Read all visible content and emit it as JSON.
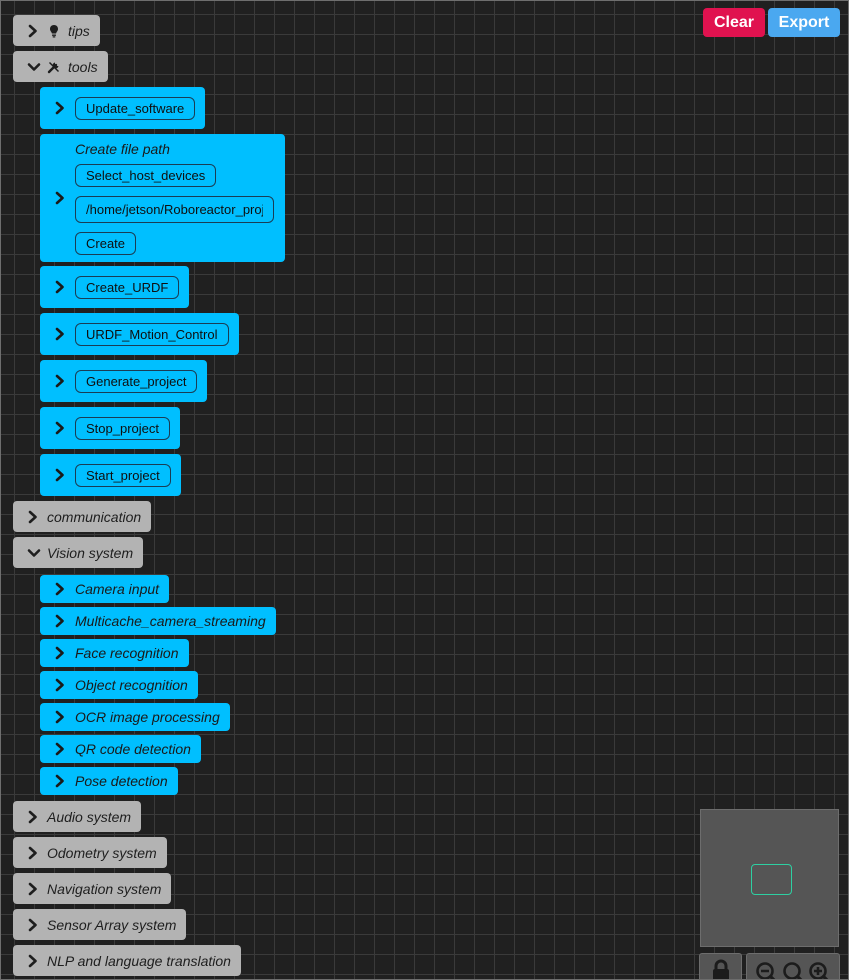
{
  "toolbar": {
    "clear_label": "Clear",
    "export_label": "Export",
    "clear_color": "#e0124f",
    "export_color": "#4aa8f0"
  },
  "categories": {
    "tips": "tips",
    "tools": "tools",
    "communication": "communication",
    "vision": "Vision system",
    "audio": "Audio system",
    "odometry": "Odometry system",
    "navigation": "Navigation system",
    "sensor": "Sensor Array system",
    "nlp": "NLP and language translation"
  },
  "tools": {
    "update_software": "Update_software",
    "create_file_path": {
      "title": "Create file path",
      "select_label": "Select_host_devices",
      "path_value": "/home/jetson/Roboreactor_projects",
      "create_label": "Create"
    },
    "create_urdf": "Create_URDF",
    "urdf_motion_control": "URDF_Motion_Control",
    "generate_project": "Generate_project",
    "stop_project": "Stop_project",
    "start_project": "Start_project"
  },
  "vision": {
    "camera_input": "Camera input",
    "multicache": "Multicache_camera_streaming",
    "face": "Face recognition",
    "object": "Object recognition",
    "ocr": "OCR image processing",
    "qr": "QR code detection",
    "pose": "Pose detection"
  },
  "icons": {
    "chevron_right": "chevron-right-icon",
    "chevron_down": "chevron-down-icon",
    "tips": "lightbulb-icon",
    "tools": "tools-icon",
    "lock": "lock-icon",
    "zoom_out": "zoom-out-icon",
    "zoom_fit": "zoom-fit-icon",
    "zoom_in": "zoom-in-icon"
  }
}
